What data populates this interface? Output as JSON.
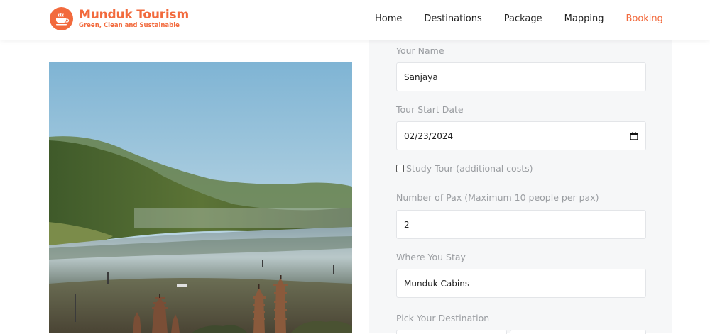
{
  "brand": {
    "name": "Munduk Tourism",
    "tagline": "Green, Clean and Sustainable",
    "color": "#f26a3d"
  },
  "nav": {
    "items": [
      {
        "label": "Home",
        "active": false
      },
      {
        "label": "Destinations",
        "active": false
      },
      {
        "label": "Package",
        "active": false
      },
      {
        "label": "Mapping",
        "active": false
      },
      {
        "label": "Booking",
        "active": true
      }
    ]
  },
  "form": {
    "name_label": "Your Name",
    "name_value": "Sanjaya",
    "start_date_label": "Tour Start Date",
    "start_date_value": "02/23/2024",
    "study_tour_label": "Study Tour (additional costs)",
    "study_tour_checked": false,
    "pax_label": "Number of Pax (Maximum 10 people per pax)",
    "pax_value": "2",
    "stay_label": "Where You Stay",
    "stay_value": "Munduk Cabins",
    "destination_label": "Pick Your Destination"
  },
  "icons": {
    "logo": "coffee-cup-icon",
    "date_picker": "calendar-icon"
  }
}
